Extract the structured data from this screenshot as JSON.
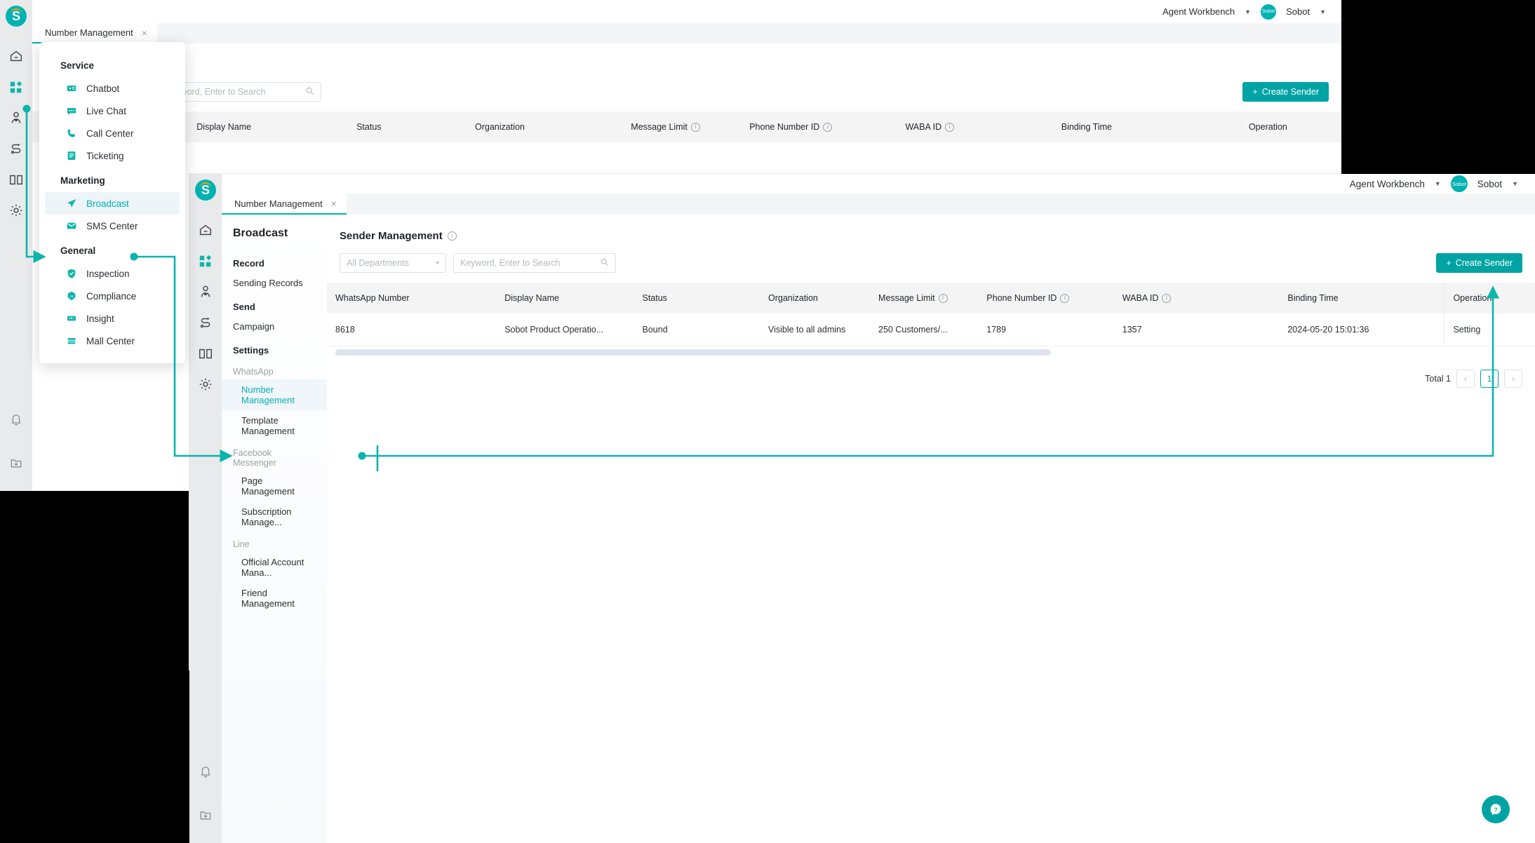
{
  "brand": {
    "accent": "#00b2b2",
    "accent_dark": "#00a3a3",
    "logo_letter": "S"
  },
  "header": {
    "workbench_label": "Agent Workbench",
    "account_label": "Sobot",
    "avatar_text": "Sobot"
  },
  "tab": {
    "label": "Number Management",
    "close": "×"
  },
  "flyout": {
    "groups": [
      {
        "title": "Service",
        "items": [
          {
            "label": "Chatbot",
            "icon": "chatbot-icon"
          },
          {
            "label": "Live Chat",
            "icon": "live-chat-icon"
          },
          {
            "label": "Call Center",
            "icon": "call-center-icon"
          },
          {
            "label": "Ticketing",
            "icon": "ticketing-icon"
          }
        ]
      },
      {
        "title": "Marketing",
        "items": [
          {
            "label": "Broadcast",
            "icon": "broadcast-icon",
            "active": true
          },
          {
            "label": "SMS Center",
            "icon": "sms-center-icon"
          }
        ]
      },
      {
        "title": "General",
        "items": [
          {
            "label": "Inspection",
            "icon": "inspection-icon"
          },
          {
            "label": "Compliance",
            "icon": "compliance-icon"
          },
          {
            "label": "Insight",
            "icon": "insight-icon"
          },
          {
            "label": "Mall Center",
            "icon": "mall-center-icon"
          }
        ]
      }
    ]
  },
  "subnav": {
    "title": "Broadcast",
    "sections": [
      {
        "kind": "group",
        "label": "Record"
      },
      {
        "kind": "item",
        "label": "Sending Records"
      },
      {
        "kind": "group",
        "label": "Send"
      },
      {
        "kind": "item",
        "label": "Campaign"
      },
      {
        "kind": "group",
        "label": "Settings"
      },
      {
        "kind": "sub",
        "label": "WhatsApp"
      },
      {
        "kind": "item",
        "label": "Number Management",
        "indent": true,
        "active": true
      },
      {
        "kind": "item",
        "label": "Template Management",
        "indent": true
      },
      {
        "kind": "sub",
        "label": "Facebook Messenger"
      },
      {
        "kind": "item",
        "label": "Page Management",
        "indent": true
      },
      {
        "kind": "item",
        "label": "Subscription Manage...",
        "indent": true
      },
      {
        "kind": "sub",
        "label": "Line"
      },
      {
        "kind": "item",
        "label": "Official Account Mana...",
        "indent": true
      },
      {
        "kind": "item",
        "label": "Friend Management",
        "indent": true
      }
    ]
  },
  "page": {
    "title": "Sender Management",
    "department_filter": "All Departments",
    "search_placeholder": "Keyword, Enter to Search",
    "create_button": "Create Sender",
    "create_button_plus": "+"
  },
  "table": {
    "columns": [
      {
        "label": "WhatsApp Number",
        "info": false
      },
      {
        "label": "Display Name",
        "info": false
      },
      {
        "label": "Status",
        "info": false
      },
      {
        "label": "Organization",
        "info": false
      },
      {
        "label": "Message Limit",
        "info": true
      },
      {
        "label": "Phone Number ID",
        "info": true
      },
      {
        "label": "WABA ID",
        "info": true
      },
      {
        "label": "Binding Time",
        "info": false
      },
      {
        "label": "Operation",
        "info": false
      }
    ],
    "rows": [
      {
        "whatsapp_number": "8618",
        "display_name": "Sobot Product Operatio...",
        "status": "Bound",
        "organization": "Visible to all admins",
        "message_limit": "250 Customers/...",
        "phone_number_id": "1789",
        "waba_id": "1357",
        "binding_time": "2024-05-20 15:01:36",
        "operation": "Setting"
      }
    ]
  },
  "pagination": {
    "total_label": "Total 1",
    "prev": "‹",
    "current_page": "1",
    "next": "›"
  },
  "help": {
    "label": "?"
  }
}
